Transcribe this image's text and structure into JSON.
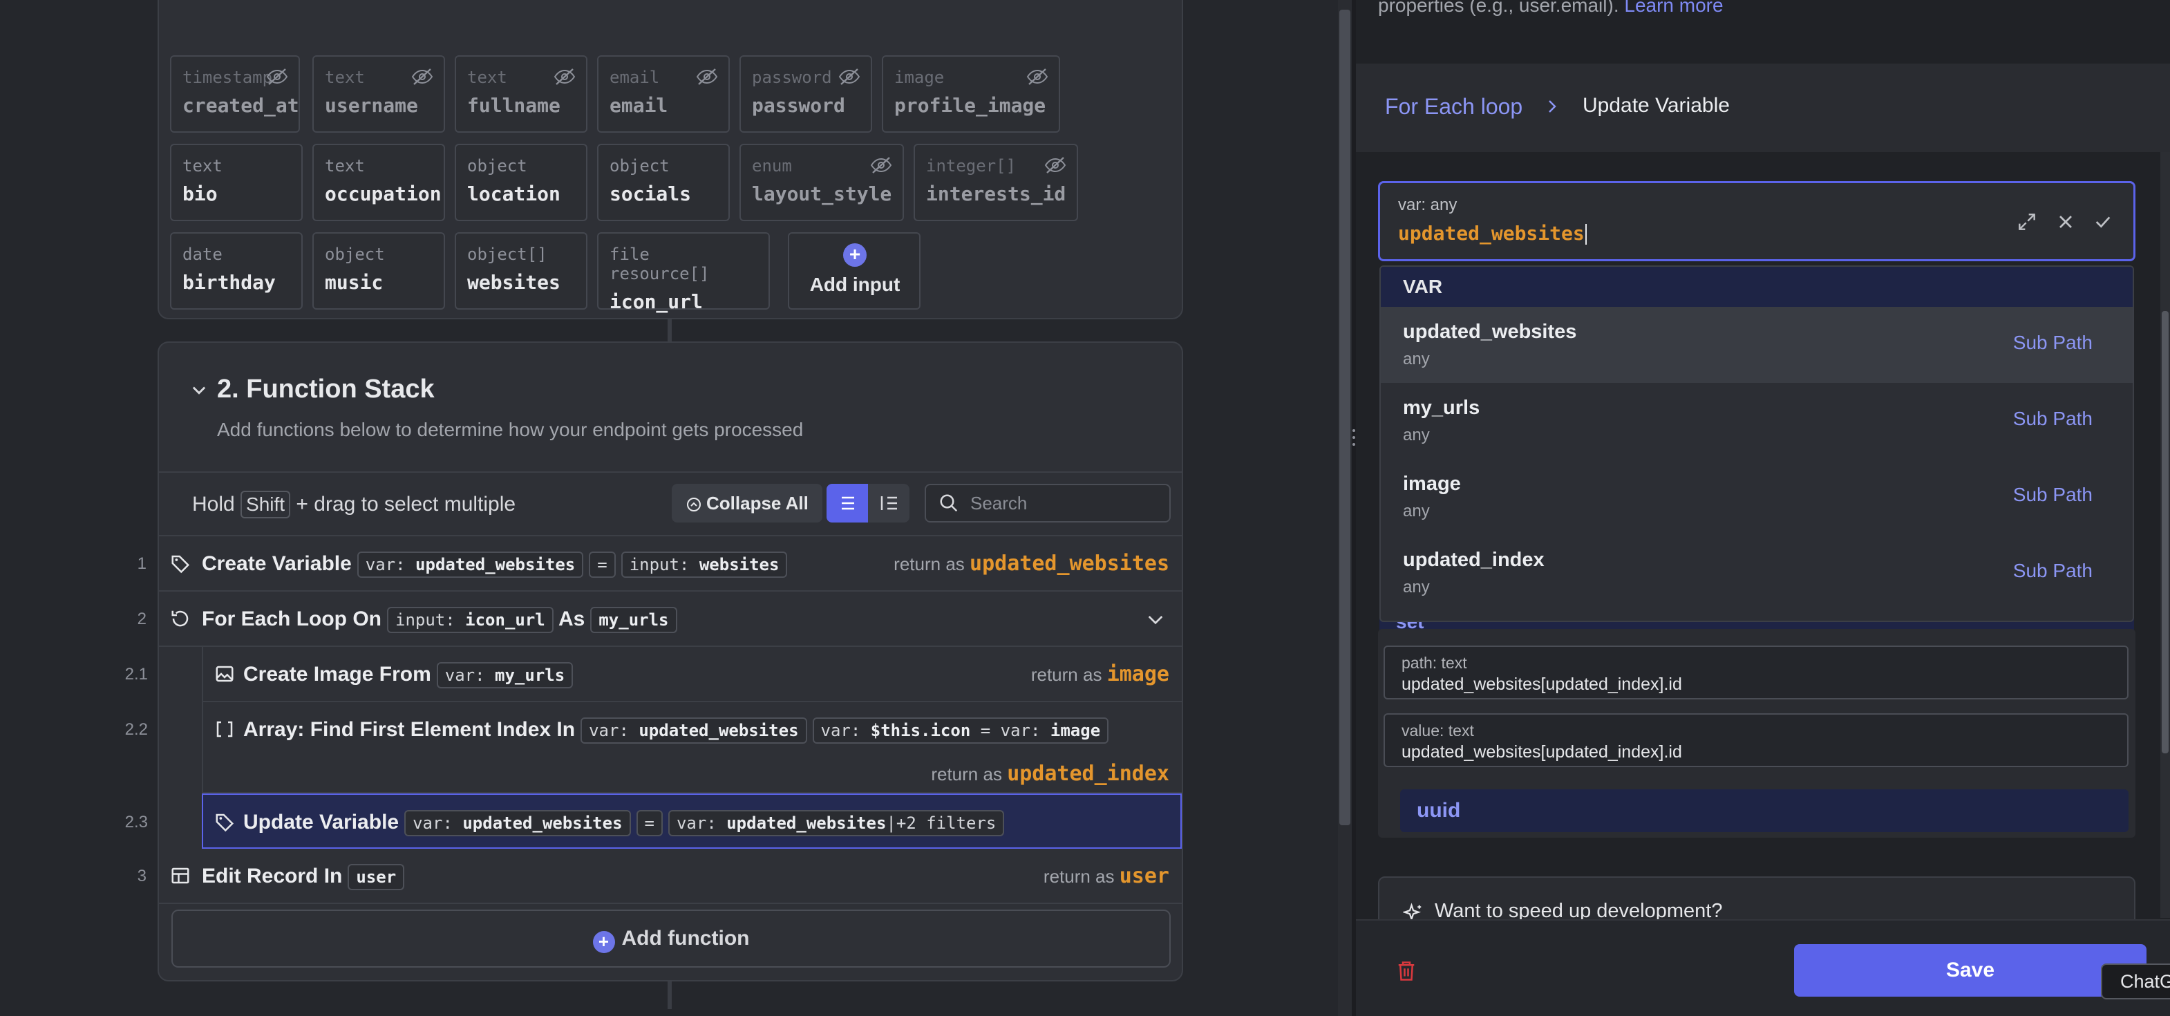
{
  "inputs": [
    {
      "type": "timestamp",
      "name": "created_at",
      "hidden": true
    },
    {
      "type": "text",
      "name": "username",
      "hidden": true
    },
    {
      "type": "text",
      "name": "fullname",
      "hidden": true
    },
    {
      "type": "email",
      "name": "email",
      "hidden": true
    },
    {
      "type": "password",
      "name": "password",
      "hidden": true
    },
    {
      "type": "image",
      "name": "profile_image",
      "hidden": true
    },
    {
      "type": "text",
      "name": "bio",
      "hidden": false
    },
    {
      "type": "text",
      "name": "occupation",
      "hidden": false
    },
    {
      "type": "object",
      "name": "location",
      "hidden": false
    },
    {
      "type": "object",
      "name": "socials",
      "hidden": false
    },
    {
      "type": "enum",
      "name": "layout_style",
      "hidden": true
    },
    {
      "type": "integer[]",
      "name": "interests_id",
      "hidden": true
    },
    {
      "type": "date",
      "name": "birthday",
      "hidden": false
    },
    {
      "type": "object",
      "name": "music",
      "hidden": false
    },
    {
      "type": "object[]",
      "name": "websites",
      "hidden": false
    },
    {
      "type": "file resource[]",
      "name": "icon_url",
      "hidden": false
    }
  ],
  "add_input_label": "Add input",
  "function_stack": {
    "title": "2. Function Stack",
    "description": "Add functions below to determine how your endpoint gets processed",
    "hold_text_1": "Hold",
    "hold_key": "Shift",
    "hold_text_2": "+ drag to select multiple",
    "collapse_all": "Collapse All",
    "search_placeholder": "Search",
    "return_as": "return as",
    "rows": {
      "r1": {
        "num": "1",
        "title": "Create Variable",
        "c1_k": "var:",
        "c1_v": "updated_websites",
        "eq": "=",
        "c2_k": "input:",
        "c2_v": "websites",
        "ret": "updated_websites"
      },
      "r2": {
        "num": "2",
        "title": "For Each Loop On",
        "c1_k": "input:",
        "c1_v": "icon_url",
        "as": "As",
        "c2_v": "my_urls"
      },
      "r21": {
        "num": "2.1",
        "title": "Create Image From",
        "c1_k": "var:",
        "c1_v": "my_urls",
        "ret": "image"
      },
      "r22": {
        "num": "2.2",
        "title": "Array: Find First Element Index In",
        "c1_k": "var:",
        "c1_v": "updated_websites",
        "c2_k": "var:",
        "c2_v": "$this.icon",
        "c2_eq": "= var:",
        "c2_v2": "image",
        "ret": "updated_index"
      },
      "r23": {
        "num": "2.3",
        "title": "Update Variable",
        "c1_k": "var:",
        "c1_v": "updated_websites",
        "eq": "=",
        "c2_k": "var:",
        "c2_v": "updated_websites",
        "c2_extra": "|+2 filters"
      },
      "r3": {
        "num": "3",
        "title": "Edit Record In",
        "c1_v": "user",
        "ret": "user"
      }
    },
    "add_function": "Add function"
  },
  "panel": {
    "props_text": "properties (e.g., user.email).",
    "learn_more": "Learn more",
    "breadcrumb": [
      "For Each loop",
      "Update Variable"
    ],
    "var_label": "var: any",
    "var_value": "updated_websites",
    "dropdown_header": "VAR",
    "dropdown_items": [
      {
        "name": "updated_websites",
        "type": "any",
        "action": "Sub Path"
      },
      {
        "name": "my_urls",
        "type": "any",
        "action": "Sub Path"
      },
      {
        "name": "image",
        "type": "any",
        "action": "Sub Path"
      },
      {
        "name": "updated_index",
        "type": "any",
        "action": "Sub Path"
      }
    ],
    "set_label": "set",
    "path_label": "path: text",
    "path_value": "updated_websites[updated_index].id",
    "value_label": "value: text",
    "value_value": "updated_websites[updated_index].id",
    "uuid": "uuid",
    "speed_text": "Want to speed up development?",
    "save": "Save",
    "chatgpt": "ChatGPT"
  },
  "colors": {
    "accent": "#5b63ea",
    "return_orange": "#e4962d",
    "link": "#8c96f5"
  }
}
